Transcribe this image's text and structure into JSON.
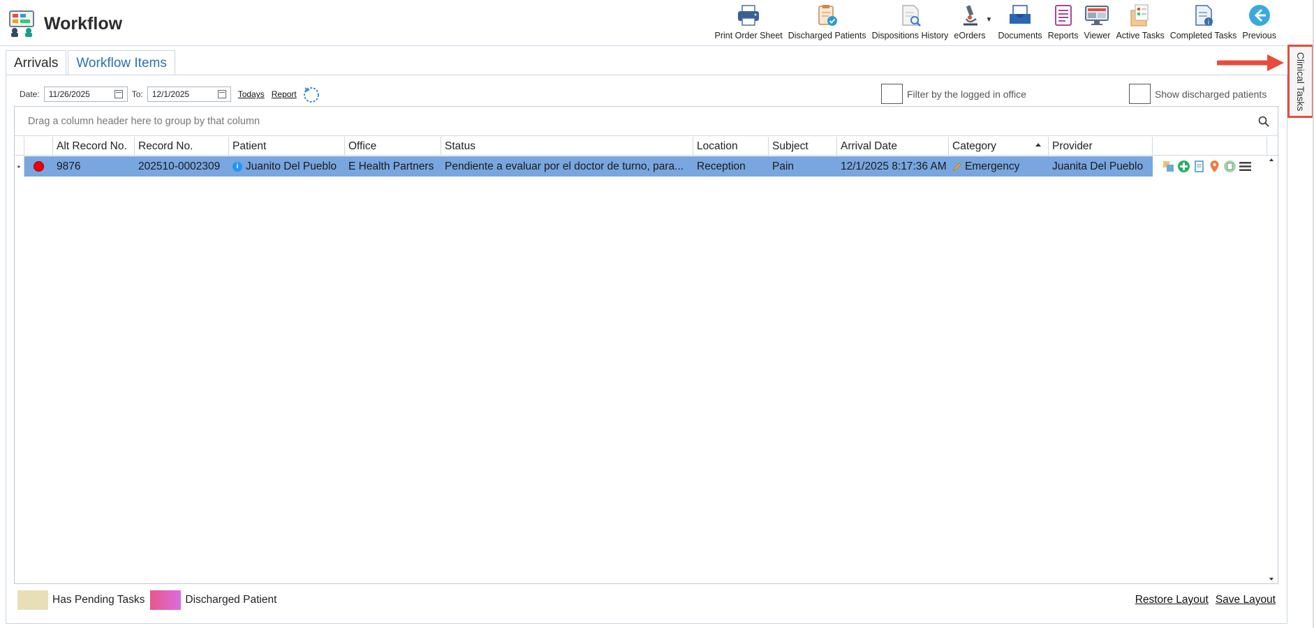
{
  "app": {
    "title": "Workflow"
  },
  "toolbar": [
    {
      "label": "Print Order Sheet",
      "icon": "printer-icon"
    },
    {
      "label": "Discharged Patients",
      "icon": "discharged-patients-icon"
    },
    {
      "label": "Dispositions History",
      "icon": "dispositions-history-icon"
    },
    {
      "label": "eOrders",
      "icon": "microscope-icon"
    },
    {
      "label": "Documents",
      "icon": "documents-tray-icon"
    },
    {
      "label": "Reports",
      "icon": "reports-icon"
    },
    {
      "label": "Viewer",
      "icon": "viewer-monitor-icon"
    },
    {
      "label": "Active Tasks",
      "icon": "active-tasks-icon"
    },
    {
      "label": "Completed Tasks",
      "icon": "completed-tasks-icon"
    },
    {
      "label": "Previous",
      "icon": "back-arrow-icon"
    }
  ],
  "side_panel": {
    "label": "Clinical Tasks"
  },
  "tabs": [
    {
      "label": "Arrivals",
      "active": true
    },
    {
      "label": "Workflow Items",
      "active": false
    }
  ],
  "filters": {
    "date_label": "Date:",
    "date_from": "11/26/2025",
    "to_label": "To:",
    "date_to": "12/1/2025",
    "todays_link": "Todays",
    "report_link": "Report",
    "filter_office_label": "Filter by the logged in office",
    "show_discharged_label": "Show discharged patients"
  },
  "grid": {
    "group_panel_text": "Drag a column header here to group by that column",
    "columns": [
      "Alt Record No.",
      "Record No.",
      "Patient",
      "Office",
      "Status",
      "Location",
      "Subject",
      "Arrival Date",
      "Category",
      "Provider"
    ],
    "rows": [
      {
        "alt_record_no": "9876",
        "record_no": "202510-0002309",
        "patient": "Juanito Del Pueblo",
        "office": "E Health Partners",
        "status": "Pendiente a evaluar por el doctor de turno, para...",
        "location": "Reception",
        "subject": "Pain",
        "arrival_date": "12/1/2025 8:17:36 AM",
        "category": "Emergency",
        "provider": "Juanita Del Pueblo"
      }
    ]
  },
  "legend": [
    {
      "label": "Has Pending Tasks",
      "color": "#e8dfb6"
    },
    {
      "label": "Discharged Patient",
      "color": "#e85d9e"
    }
  ],
  "footer": {
    "restore_layout": "Restore Layout",
    "save_layout": "Save Layout"
  },
  "colors": {
    "selected_row": "#79a6df",
    "accent_link": "#2a6fb6",
    "highlight_border": "#e74c3c"
  }
}
